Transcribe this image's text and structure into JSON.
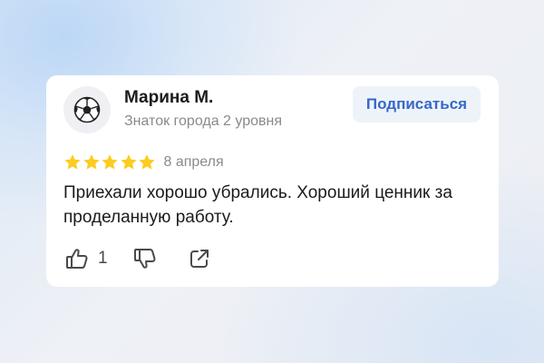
{
  "review": {
    "author": {
      "name": "Марина М.",
      "status": "Знаток города 2 уровня",
      "avatar_icon": "soccer-ball-icon"
    },
    "subscribe_label": "Подписаться",
    "rating": 5,
    "max_rating": 5,
    "date": "8 апреля",
    "text": "Приехали хорошо убрались. Хороший ценник за проделанную работу.",
    "likes": "1",
    "icons": {
      "like": "thumbs-up-icon",
      "dislike": "thumbs-down-icon",
      "share": "share-icon",
      "star": "star-icon"
    }
  },
  "colors": {
    "star": "#fccc1f",
    "subscribe_text": "#3568c9",
    "subscribe_bg": "#eef3f9",
    "muted_text": "#8a8a8a",
    "main_text": "#1b1b1b"
  }
}
